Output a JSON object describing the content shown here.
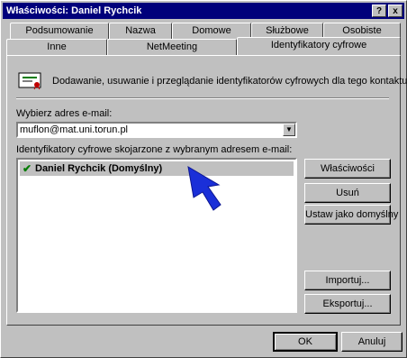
{
  "window": {
    "title": "Właściwości: Daniel Rychcik"
  },
  "titlebar_buttons": {
    "help": "?",
    "close": "x"
  },
  "tabs_row1": [
    {
      "label": "Podsumowanie"
    },
    {
      "label": "Nazwa"
    },
    {
      "label": "Domowe"
    },
    {
      "label": "Służbowe"
    },
    {
      "label": "Osobiste"
    }
  ],
  "tabs_row2": [
    {
      "label": "Inne"
    },
    {
      "label": "NetMeeting"
    },
    {
      "label": "Identyfikatory cyfrowe",
      "active": true
    }
  ],
  "main": {
    "description": "Dodawanie, usuwanie i przeglądanie identyfikatorów cyfrowych dla tego kontaktu.",
    "email_label": "Wybierz adres e-mail:",
    "email_value": "muflon@mat.uni.torun.pl",
    "ids_label": "Identyfikatory cyfrowe skojarzone z wybranym adresem e-mail:",
    "list": [
      {
        "name": "Daniel Rychcik  (Domyślny)",
        "checked": true
      }
    ]
  },
  "side_buttons": {
    "properties": "Właściwości",
    "remove": "Usuń",
    "set_default": "Ustaw jako domyślny",
    "import": "Importuj...",
    "export": "Eksportuj..."
  },
  "footer": {
    "ok": "OK",
    "cancel": "Anuluj"
  },
  "colors": {
    "titlebar": "#00007b",
    "face": "#c0c0c0",
    "pointer": "#1a2fd8",
    "check": "#007b00"
  }
}
